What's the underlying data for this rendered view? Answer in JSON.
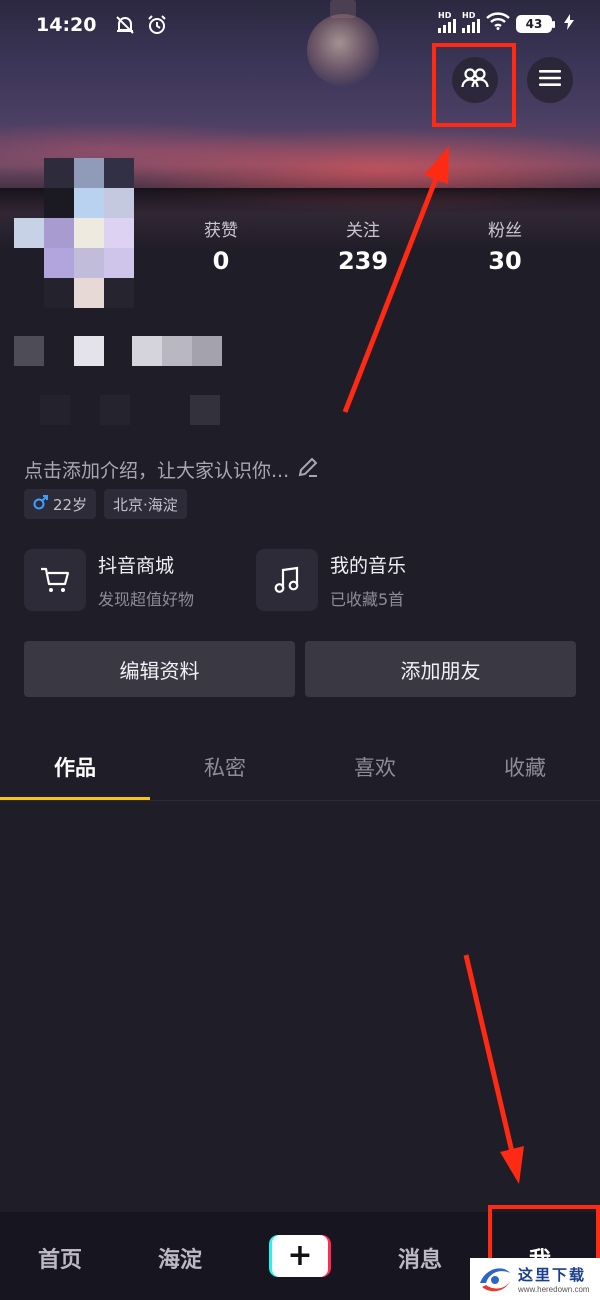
{
  "status_bar": {
    "time": "14:20",
    "icons": [
      "mute-icon",
      "alarm-icon",
      "signal-hd-icon",
      "signal-hd-icon",
      "wifi-icon",
      "battery-icon",
      "charging-icon"
    ],
    "hd_label": "HD",
    "battery_level": "43"
  },
  "header": {
    "friends_button_icon": "friends-icon",
    "menu_button_icon": "menu-icon"
  },
  "stats": [
    {
      "label": "获赞",
      "value": "0"
    },
    {
      "label": "关注",
      "value": "239"
    },
    {
      "label": "粉丝",
      "value": "30"
    }
  ],
  "profile": {
    "bio_placeholder": "点击添加介绍，让大家认识你...",
    "tags": [
      {
        "icon": "male-icon",
        "text": "22岁"
      },
      {
        "text": "北京·海淀"
      }
    ]
  },
  "shortcuts": [
    {
      "icon": "cart-icon",
      "title": "抖音商城",
      "subtitle": "发现超值好物"
    },
    {
      "icon": "music-icon",
      "title": "我的音乐",
      "subtitle": "已收藏5首"
    }
  ],
  "actions": {
    "edit_profile": "编辑资料",
    "add_friends": "添加朋友"
  },
  "tabs": [
    {
      "label": "作品",
      "active": true
    },
    {
      "label": "私密",
      "active": false
    },
    {
      "label": "喜欢",
      "active": false
    },
    {
      "label": "收藏",
      "active": false
    }
  ],
  "bottom_nav": [
    {
      "label": "首页",
      "active": false
    },
    {
      "label": "海淀",
      "active": false
    },
    {
      "label": "+",
      "active": false
    },
    {
      "label": "消息",
      "active": false
    },
    {
      "label": "我",
      "active": true
    }
  ],
  "watermark": {
    "name": "这里下载",
    "url": "www.heredown.com"
  },
  "colors": {
    "background": "#1f1d27",
    "tab_indicator": "#f5c518",
    "annotation": "#ff2a13",
    "male_icon": "#3aa0ff"
  }
}
